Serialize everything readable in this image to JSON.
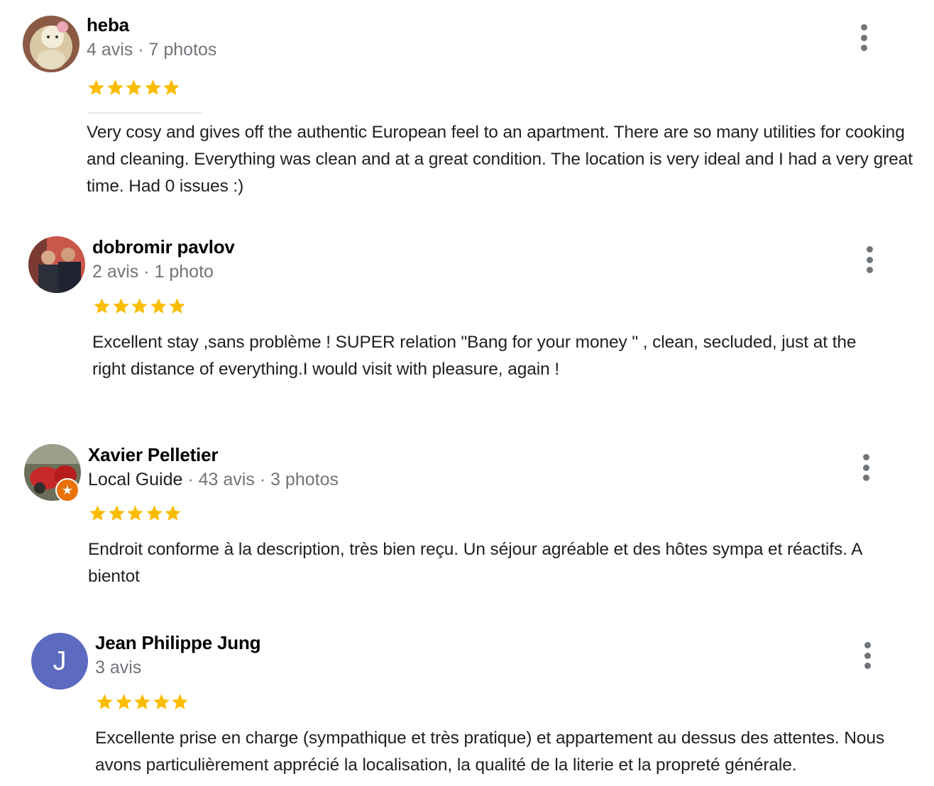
{
  "reviews": [
    {
      "name": "heba",
      "meta": "4 avis · 7 photos",
      "guide": "",
      "rating": 5,
      "text": "Very cosy and gives off the authentic European feel to an apartment. There are so many utilities for cooking and cleaning. Everything was clean and at a great condition. The location is very ideal and I had a very great time. Had 0 issues :)",
      "avatar": "photo-avatar"
    },
    {
      "name": "dobromir pavlov",
      "meta": "2 avis · 1 photo",
      "guide": "",
      "rating": 5,
      "text": "Excellent stay ,sans problème ! SUPER relation \"Bang for your money \" , clean, secluded, just at the right distance of everything.I would visit with pleasure, again !",
      "avatar": "photo-avatar"
    },
    {
      "name": "Xavier Pelletier",
      "meta": " · 43 avis · 3 photos",
      "guide": "Local Guide",
      "rating": 5,
      "text": "Endroit conforme à la description, très bien reçu. Un séjour agréable et des hôtes sympa et réactifs. A bientot",
      "avatar": "photo-avatar"
    },
    {
      "name": "Jean Philippe Jung",
      "meta": "3 avis",
      "guide": "",
      "rating": 5,
      "text": "Excellente prise en charge (sympathique et très pratique) et appartement au dessus des attentes. Nous avons particulièrement apprécié la localisation, la qualité de la literie et la propreté générale.",
      "avatar": "letter-avatar",
      "initial": "J"
    }
  ],
  "colors": {
    "star": "#fbbc04",
    "meta": "#70757a",
    "text": "#202124",
    "letter_avatar_bg": "#5c6bc0",
    "local_guide_badge": "#e8710a"
  },
  "icons": {
    "more": "more-vert-icon",
    "star": "star-icon",
    "badge": "local-guide-star-icon"
  }
}
